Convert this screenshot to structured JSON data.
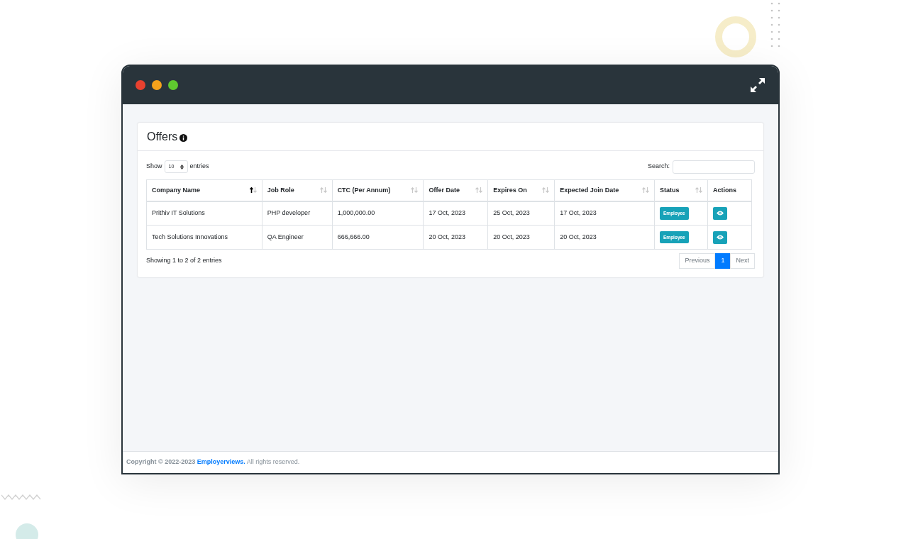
{
  "window": {
    "traffic_lights": [
      {
        "color": "#e8412f"
      },
      {
        "color": "#f5a21b"
      },
      {
        "color": "#5fc92f"
      }
    ]
  },
  "card": {
    "title": "Offers",
    "length": {
      "label_before": "Show",
      "value": "10",
      "label_after": "entries"
    },
    "search": {
      "label": "Search:"
    },
    "table": {
      "columns": [
        {
          "label": "Company Name",
          "sortable": true,
          "sorted": true
        },
        {
          "label": "Job Role",
          "sortable": true,
          "sorted": false
        },
        {
          "label": "CTC (Per Annum)",
          "sortable": true,
          "sorted": false
        },
        {
          "label": "Offer Date",
          "sortable": true,
          "sorted": false
        },
        {
          "label": "Expires On",
          "sortable": true,
          "sorted": false
        },
        {
          "label": "Expected Join Date",
          "sortable": true,
          "sorted": false
        },
        {
          "label": "Status",
          "sortable": true,
          "sorted": false
        },
        {
          "label": "Actions",
          "sortable": false,
          "sorted": false
        }
      ],
      "rows": [
        {
          "cells": [
            "Prithiv IT Solutions",
            "PHP developer",
            "1,000,000.00",
            "17 Oct, 2023",
            "25 Oct, 2023",
            "17 Oct, 2023"
          ],
          "status": "Employee"
        },
        {
          "cells": [
            "Tech Solutions Innovations",
            "QA Engineer",
            "666,666.00",
            "20 Oct, 2023",
            "20 Oct, 2023",
            "20 Oct, 2023"
          ],
          "status": "Employee"
        }
      ]
    },
    "info": "Showing 1 to 2 of 2 entries",
    "pagination": [
      {
        "label": "Previous",
        "kind": "nav",
        "selected": false
      },
      {
        "label": "1",
        "kind": "page",
        "selected": true
      },
      {
        "label": "Next",
        "kind": "nav",
        "selected": false
      }
    ]
  },
  "footer": {
    "prefix": "Copyright © 2022-2023",
    "brand": "Employerviews.",
    "suffix": "All rights reserved."
  }
}
